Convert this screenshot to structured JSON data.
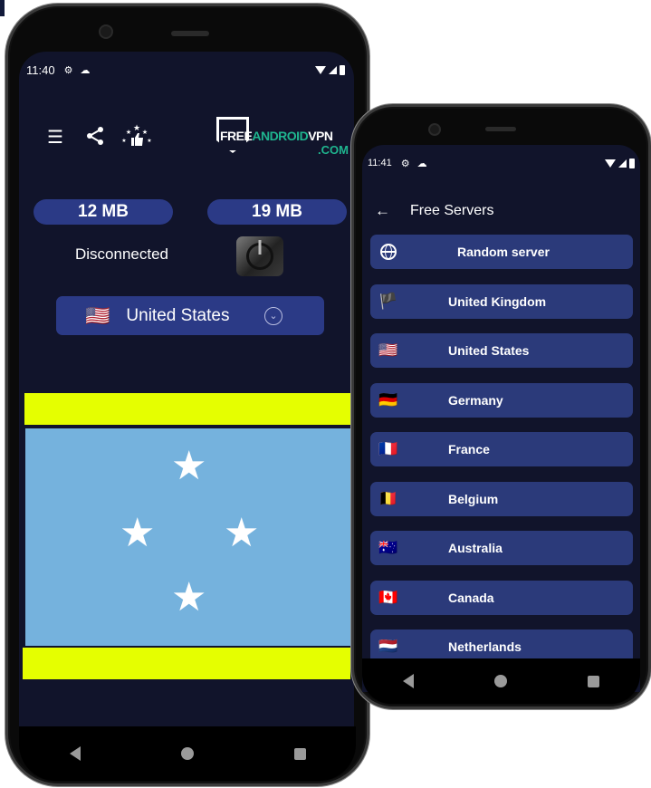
{
  "phone1": {
    "status": {
      "time": "11:40",
      "icons": [
        "gear-icon",
        "cloud-icon",
        "wifi-icon",
        "signal-icon",
        "battery-icon"
      ]
    },
    "toolbar": {
      "menu_icon": "☰",
      "share_icon": "<",
      "rate_icon": "★",
      "logo": {
        "free": "FREE",
        "android": "ANDROID",
        "vpn": "VPN",
        "com": ".COM"
      }
    },
    "usage": {
      "download": "12 MB",
      "upload": "19 MB"
    },
    "connection_status": "Disconnected",
    "selected_country": {
      "flag": "🇺🇸",
      "name": "United States",
      "chevron": "⌄"
    },
    "flag_display": {
      "country": "Micronesia",
      "colors": {
        "stripe": "#e5ff00",
        "field": "#75b2dd",
        "star": "#ffffff"
      }
    },
    "navbar": {
      "back": "back",
      "home": "home",
      "recent": "recent"
    }
  },
  "phone2": {
    "status": {
      "time": "11:41"
    },
    "header": {
      "back_icon": "←",
      "title": "Free Servers"
    },
    "servers": [
      {
        "flag": "globe",
        "name": "Random server"
      },
      {
        "flag": "🏴",
        "name": "United Kingdom"
      },
      {
        "flag": "🇺🇸",
        "name": "United States"
      },
      {
        "flag": "🇩🇪",
        "name": "Germany"
      },
      {
        "flag": "🇫🇷",
        "name": "France"
      },
      {
        "flag": "🇧🇪",
        "name": "Belgium"
      },
      {
        "flag": "🇦🇺",
        "name": "Australia"
      },
      {
        "flag": "🇨🇦",
        "name": "Canada"
      },
      {
        "flag": "🇳🇱",
        "name": "Netherlands"
      }
    ]
  },
  "colors": {
    "background": "#11142b",
    "accent": "#2b3a86",
    "logo_green": "#1fb58f"
  }
}
